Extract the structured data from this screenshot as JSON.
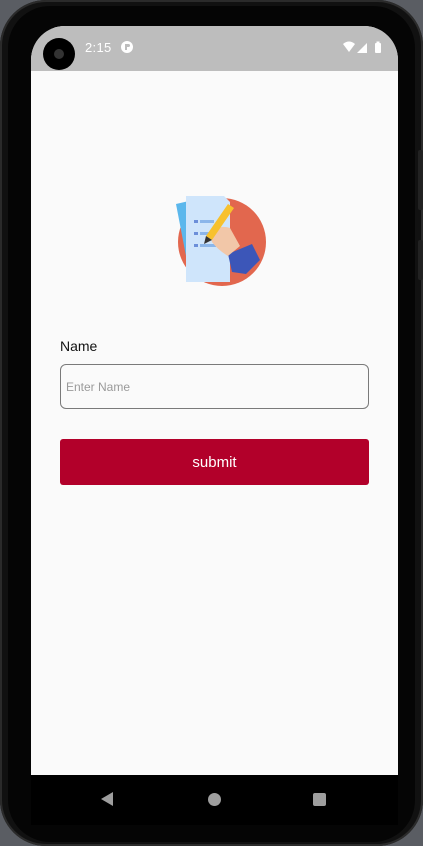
{
  "status_bar": {
    "time": "2:15",
    "icons": [
      "camera-icon",
      "notification-icon",
      "wifi-icon",
      "signal-icon",
      "battery-icon"
    ]
  },
  "app": {
    "logo_icon": "document-writing-icon",
    "name_label": "Name",
    "name_input": {
      "value": "",
      "placeholder": "Enter Name"
    },
    "submit_label": "submit",
    "colors": {
      "accent": "#b2002a",
      "background": "#fafafa",
      "status_bar": "#bdbdbd"
    }
  },
  "nav_bar": {
    "icons": [
      "back-icon",
      "home-icon",
      "recents-icon"
    ]
  }
}
